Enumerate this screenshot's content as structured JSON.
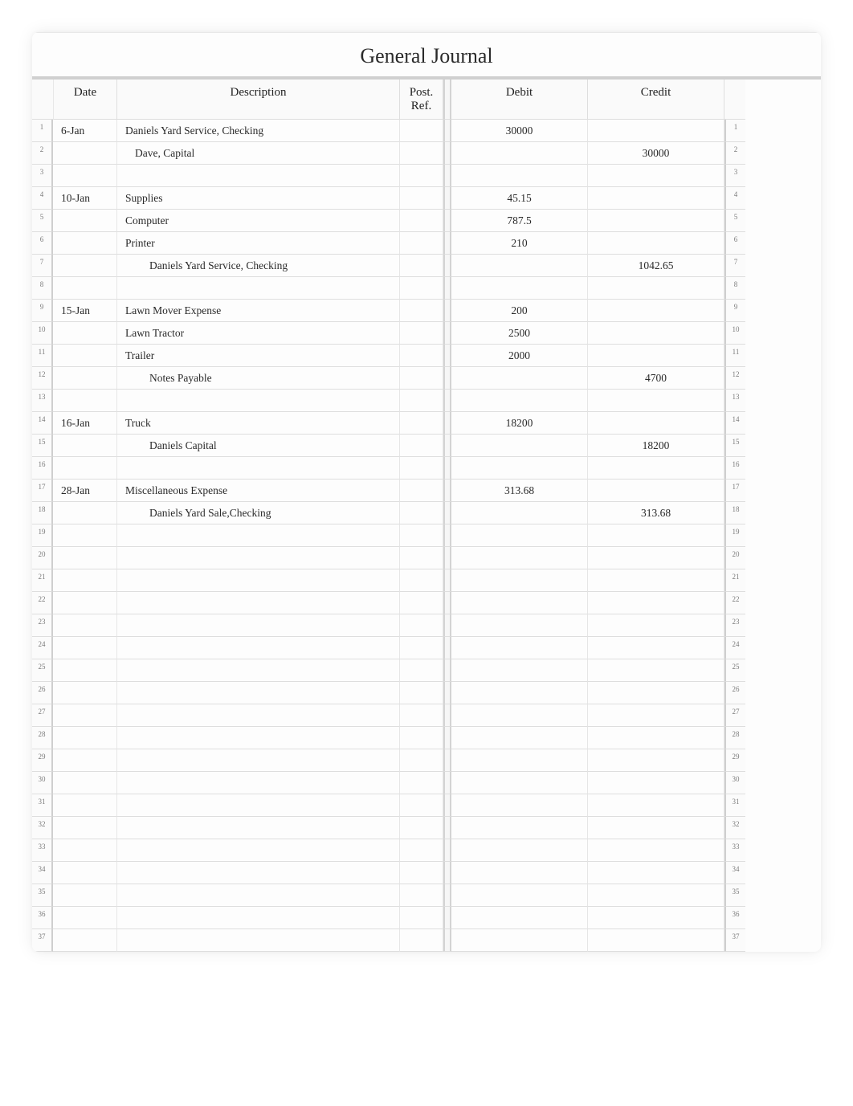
{
  "title": "General Journal",
  "columns": {
    "date": "Date",
    "description": "Description",
    "post_ref": "Post.\nRef.",
    "debit": "Debit",
    "credit": "Credit"
  },
  "rows": [
    {
      "n": 1,
      "date": "6-Jan",
      "description": "Daniels Yard Service, Checking",
      "indent": 0,
      "post_ref": "",
      "debit": "30000",
      "credit": ""
    },
    {
      "n": 2,
      "date": "",
      "description": "Dave, Capital",
      "indent": 1,
      "post_ref": "",
      "debit": "",
      "credit": "30000"
    },
    {
      "n": 3,
      "date": "",
      "description": "",
      "indent": 0,
      "post_ref": "",
      "debit": "",
      "credit": ""
    },
    {
      "n": 4,
      "date": "10-Jan",
      "description": "Supplies",
      "indent": 0,
      "post_ref": "",
      "debit": "45.15",
      "credit": ""
    },
    {
      "n": 5,
      "date": "",
      "description": "Computer",
      "indent": 0,
      "post_ref": "",
      "debit": "787.5",
      "credit": ""
    },
    {
      "n": 6,
      "date": "",
      "description": "Printer",
      "indent": 0,
      "post_ref": "",
      "debit": "210",
      "credit": ""
    },
    {
      "n": 7,
      "date": "",
      "description": "Daniels Yard Service, Checking",
      "indent": 2,
      "post_ref": "",
      "debit": "",
      "credit": "1042.65"
    },
    {
      "n": 8,
      "date": "",
      "description": "",
      "indent": 0,
      "post_ref": "",
      "debit": "",
      "credit": ""
    },
    {
      "n": 9,
      "date": "15-Jan",
      "description": "Lawn Mover Expense",
      "indent": 0,
      "post_ref": "",
      "debit": "200",
      "credit": ""
    },
    {
      "n": 10,
      "date": "",
      "description": "Lawn Tractor",
      "indent": 0,
      "post_ref": "",
      "debit": "2500",
      "credit": ""
    },
    {
      "n": 11,
      "date": "",
      "description": "Trailer",
      "indent": 0,
      "post_ref": "",
      "debit": "2000",
      "credit": ""
    },
    {
      "n": 12,
      "date": "",
      "description": "Notes Payable",
      "indent": 2,
      "post_ref": "",
      "debit": "",
      "credit": "4700"
    },
    {
      "n": 13,
      "date": "",
      "description": "",
      "indent": 0,
      "post_ref": "",
      "debit": "",
      "credit": ""
    },
    {
      "n": 14,
      "date": "16-Jan",
      "description": "Truck",
      "indent": 0,
      "post_ref": "",
      "debit": "18200",
      "credit": ""
    },
    {
      "n": 15,
      "date": "",
      "description": "Daniels Capital",
      "indent": 2,
      "post_ref": "",
      "debit": "",
      "credit": "18200"
    },
    {
      "n": 16,
      "date": "",
      "description": "",
      "indent": 0,
      "post_ref": "",
      "debit": "",
      "credit": ""
    },
    {
      "n": 17,
      "date": "28-Jan",
      "description": "Miscellaneous Expense",
      "indent": 0,
      "post_ref": "",
      "debit": "313.68",
      "credit": ""
    },
    {
      "n": 18,
      "date": "",
      "description": "Daniels Yard Sale,Checking",
      "indent": 2,
      "post_ref": "",
      "debit": "",
      "credit": "313.68"
    },
    {
      "n": 19,
      "date": "",
      "description": "",
      "indent": 0,
      "post_ref": "",
      "debit": "",
      "credit": ""
    },
    {
      "n": 20,
      "date": "",
      "description": "",
      "indent": 0,
      "post_ref": "",
      "debit": "",
      "credit": ""
    },
    {
      "n": 21,
      "date": "",
      "description": "",
      "indent": 0,
      "post_ref": "",
      "debit": "",
      "credit": ""
    },
    {
      "n": 22,
      "date": "",
      "description": "",
      "indent": 0,
      "post_ref": "",
      "debit": "",
      "credit": ""
    },
    {
      "n": 23,
      "date": "",
      "description": "",
      "indent": 0,
      "post_ref": "",
      "debit": "",
      "credit": ""
    },
    {
      "n": 24,
      "date": "",
      "description": "",
      "indent": 0,
      "post_ref": "",
      "debit": "",
      "credit": ""
    },
    {
      "n": 25,
      "date": "",
      "description": "",
      "indent": 0,
      "post_ref": "",
      "debit": "",
      "credit": ""
    },
    {
      "n": 26,
      "date": "",
      "description": "",
      "indent": 0,
      "post_ref": "",
      "debit": "",
      "credit": ""
    },
    {
      "n": 27,
      "date": "",
      "description": "",
      "indent": 0,
      "post_ref": "",
      "debit": "",
      "credit": ""
    },
    {
      "n": 28,
      "date": "",
      "description": "",
      "indent": 0,
      "post_ref": "",
      "debit": "",
      "credit": ""
    },
    {
      "n": 29,
      "date": "",
      "description": "",
      "indent": 0,
      "post_ref": "",
      "debit": "",
      "credit": ""
    },
    {
      "n": 30,
      "date": "",
      "description": "",
      "indent": 0,
      "post_ref": "",
      "debit": "",
      "credit": ""
    },
    {
      "n": 31,
      "date": "",
      "description": "",
      "indent": 0,
      "post_ref": "",
      "debit": "",
      "credit": ""
    },
    {
      "n": 32,
      "date": "",
      "description": "",
      "indent": 0,
      "post_ref": "",
      "debit": "",
      "credit": ""
    },
    {
      "n": 33,
      "date": "",
      "description": "",
      "indent": 0,
      "post_ref": "",
      "debit": "",
      "credit": ""
    },
    {
      "n": 34,
      "date": "",
      "description": "",
      "indent": 0,
      "post_ref": "",
      "debit": "",
      "credit": ""
    },
    {
      "n": 35,
      "date": "",
      "description": "",
      "indent": 0,
      "post_ref": "",
      "debit": "",
      "credit": ""
    },
    {
      "n": 36,
      "date": "",
      "description": "",
      "indent": 0,
      "post_ref": "",
      "debit": "",
      "credit": ""
    },
    {
      "n": 37,
      "date": "",
      "description": "",
      "indent": 0,
      "post_ref": "",
      "debit": "",
      "credit": ""
    }
  ]
}
